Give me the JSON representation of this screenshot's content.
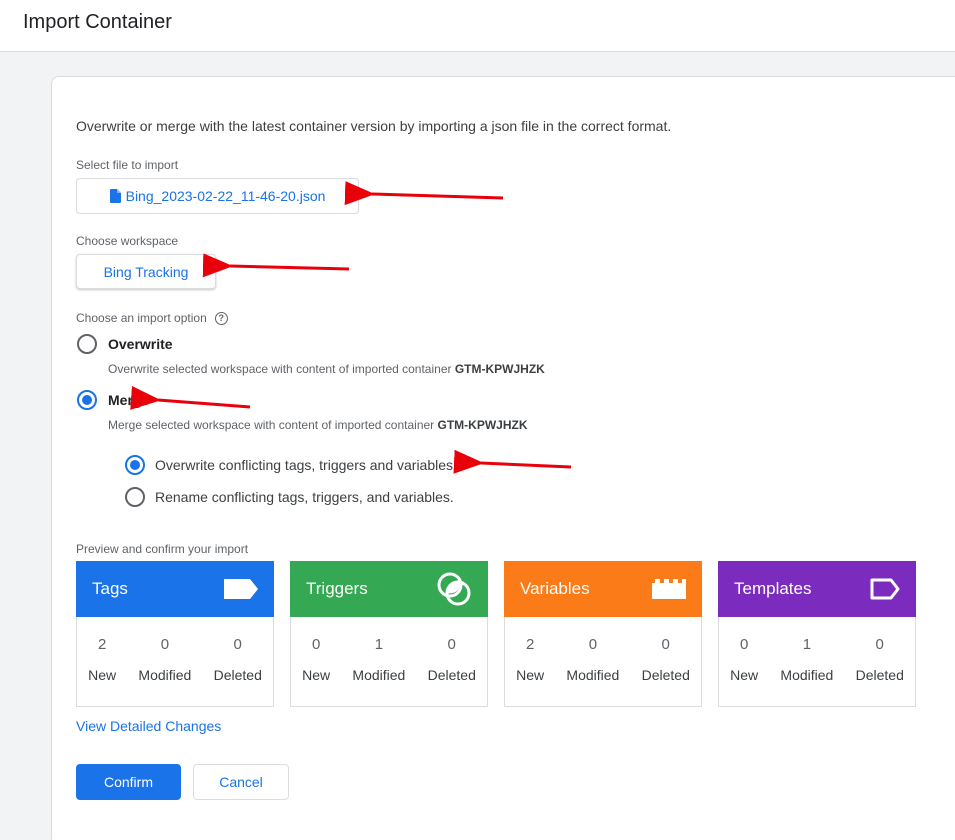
{
  "header": {
    "title": "Import Container"
  },
  "intro": "Overwrite or merge with the latest container version by importing a json file in the correct format.",
  "file": {
    "label": "Select file to import",
    "filename": "Bing_2023-02-22_11-46-20.json",
    "icon": "file-icon"
  },
  "workspace": {
    "label": "Choose workspace",
    "value": "Bing Tracking"
  },
  "import_option": {
    "label": "Choose an import option",
    "help_icon": "help-icon",
    "overwrite": {
      "title": "Overwrite",
      "desc_prefix": "Overwrite selected workspace with content of imported container ",
      "container": "GTM-KPWJHZK",
      "selected": false
    },
    "merge": {
      "title": "Merge",
      "desc_prefix": "Merge selected workspace with content of imported container ",
      "container": "GTM-KPWJHZK",
      "selected": true
    },
    "conflict_overwrite": {
      "label": "Overwrite conflicting tags, triggers and variables.",
      "selected": true
    },
    "conflict_rename": {
      "label": "Rename conflicting tags, triggers, and variables.",
      "selected": false
    }
  },
  "preview": {
    "label": "Preview and confirm your import",
    "tiles": [
      {
        "name": "Tags",
        "color": "#1a73e8",
        "icon": "tag-icon",
        "new": "2",
        "modified": "0",
        "deleted": "0"
      },
      {
        "name": "Triggers",
        "color": "#34a853",
        "icon": "trigger-icon",
        "new": "0",
        "modified": "1",
        "deleted": "0"
      },
      {
        "name": "Variables",
        "color": "#fa7b17",
        "icon": "variable-blocks-icon",
        "new": "2",
        "modified": "0",
        "deleted": "0"
      },
      {
        "name": "Templates",
        "color": "#7b2cbf",
        "icon": "template-tag-outline-icon",
        "new": "0",
        "modified": "1",
        "deleted": "0"
      }
    ],
    "captions": {
      "new": "New",
      "modified": "Modified",
      "deleted": "Deleted"
    }
  },
  "view_changes": "View Detailed Changes",
  "actions": {
    "confirm": "Confirm",
    "cancel": "Cancel"
  },
  "annotations": {
    "arrow_color": "#e8000a"
  }
}
